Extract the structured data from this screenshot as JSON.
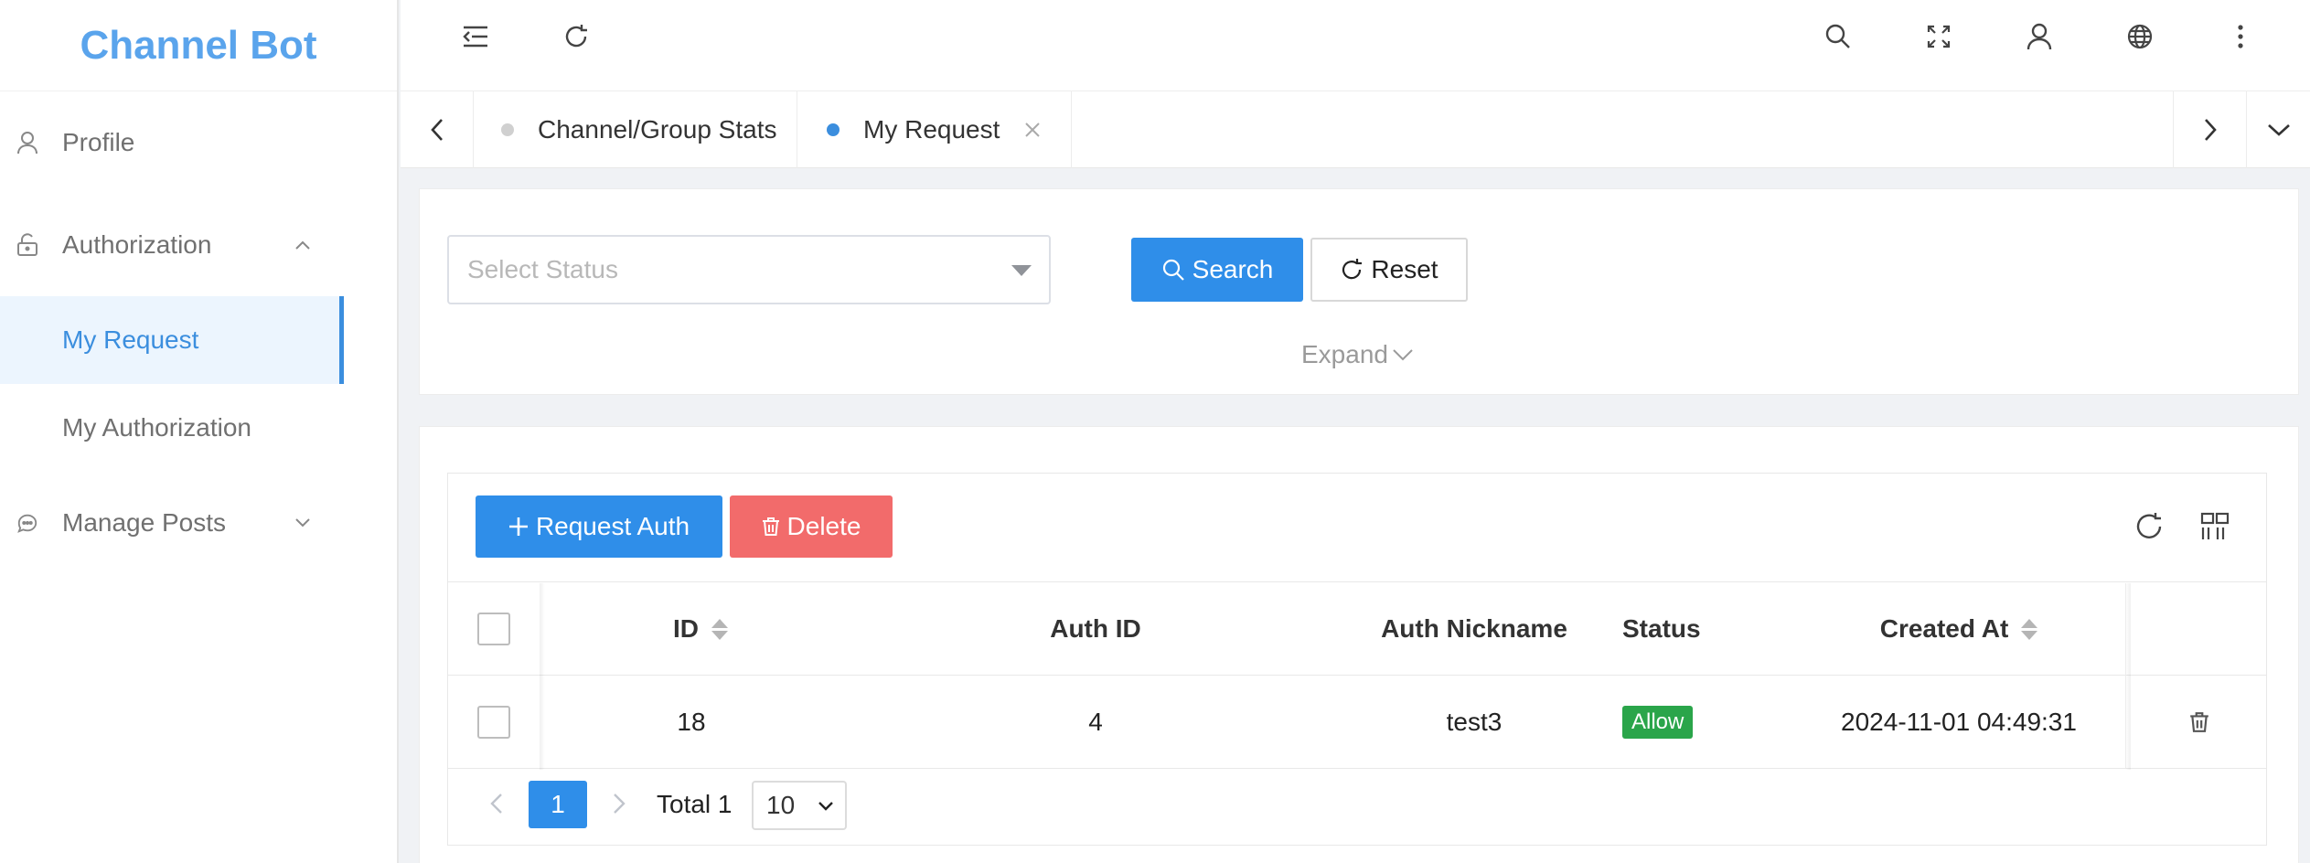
{
  "app": {
    "title": "Channel Bot"
  },
  "sidebar": {
    "items": [
      {
        "label": "Profile",
        "icon": "user-icon"
      },
      {
        "label": "Authorization",
        "icon": "lock-icon",
        "expanded": true
      },
      {
        "label": "My Request",
        "active": true
      },
      {
        "label": "My Authorization"
      },
      {
        "label": "Manage Posts",
        "icon": "chat-icon",
        "expanded": false
      }
    ]
  },
  "header": {
    "icons": [
      "menu-fold-icon",
      "refresh-icon",
      "search-icon",
      "fullscreen-icon",
      "user-icon",
      "globe-icon",
      "more-icon"
    ]
  },
  "tabs": [
    {
      "label": "Channel/Group Stats",
      "active": false
    },
    {
      "label": "My Request",
      "active": true,
      "closable": true
    }
  ],
  "filter": {
    "status_placeholder": "Select Status",
    "search_label": "Search",
    "reset_label": "Reset",
    "expand_label": "Expand"
  },
  "toolbar": {
    "request_auth_label": "Request Auth",
    "delete_label": "Delete"
  },
  "table": {
    "columns": [
      "ID",
      "Auth ID",
      "Auth Nickname",
      "Status",
      "Created At"
    ],
    "rows": [
      {
        "id": "18",
        "auth_id": "4",
        "auth_nickname": "test3",
        "status": "Allow",
        "created_at": "2024-11-01 04:49:31"
      }
    ]
  },
  "pagination": {
    "current_page": "1",
    "total_label": "Total 1",
    "page_size": "10"
  },
  "colors": {
    "primary": "#2f8ee9",
    "danger": "#f26b6b",
    "success": "#2aa54a",
    "brand": "#5aa4ec"
  }
}
